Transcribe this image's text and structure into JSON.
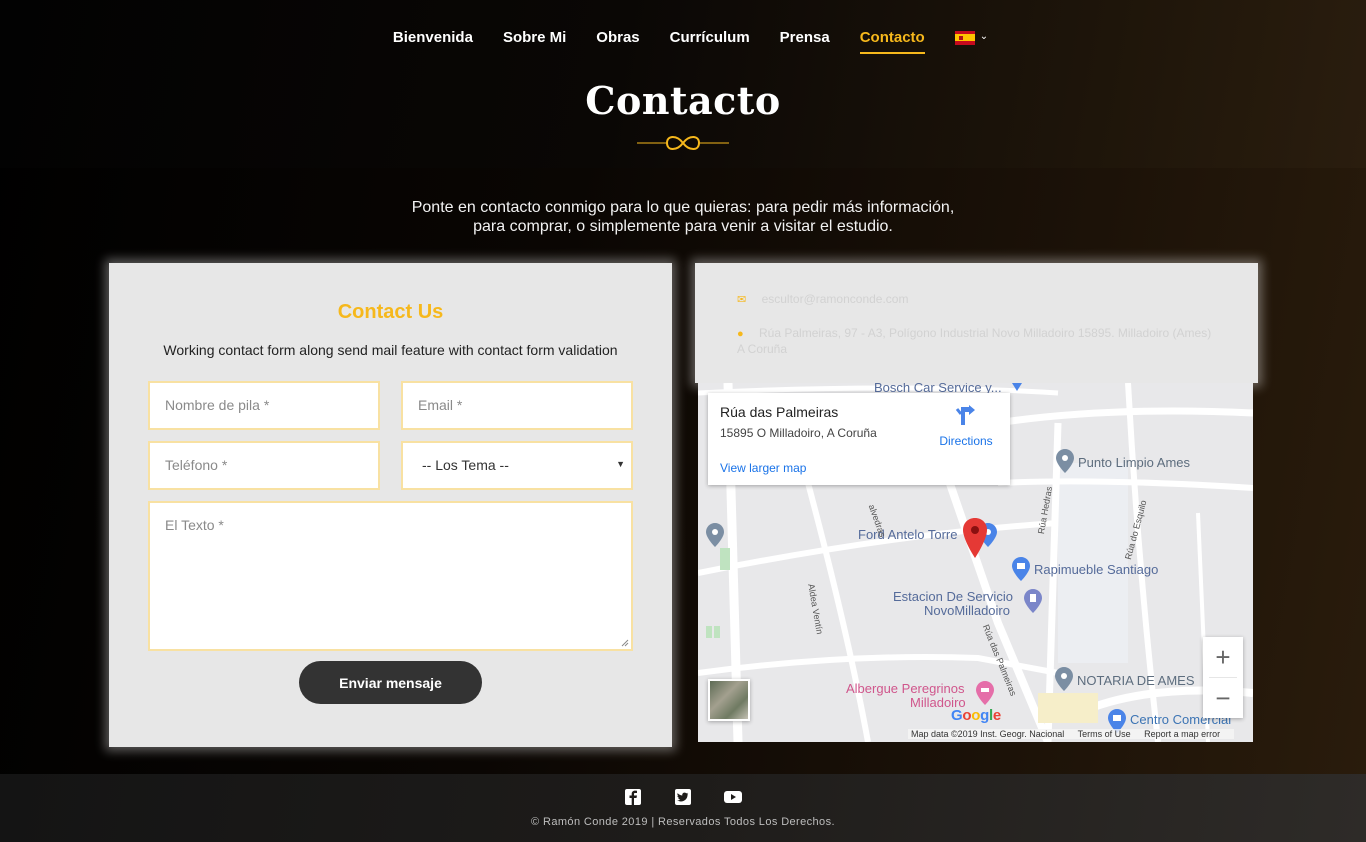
{
  "nav": {
    "items": [
      {
        "label": "Bienvenida"
      },
      {
        "label": "Sobre Mi"
      },
      {
        "label": "Obras"
      },
      {
        "label": "Currículum"
      },
      {
        "label": "Prensa"
      },
      {
        "label": "Contacto",
        "active": true
      }
    ],
    "language_icon": "spain-flag-icon"
  },
  "header": {
    "title": "Contacto"
  },
  "intro": {
    "line1": "Ponte en contacto conmigo para lo que quieras: para pedir más información,",
    "line2": "para comprar, o simplemente para venir a visitar el estudio."
  },
  "form": {
    "title": "Contact Us",
    "subtitle": "Working contact form along send mail feature with contact form validation",
    "name_placeholder": "Nombre de pila *",
    "email_placeholder": "Email *",
    "phone_placeholder": "Teléfono *",
    "topic_selected": "-- Los Tema --",
    "text_placeholder": "El Texto *",
    "submit_label": "Enviar mensaje"
  },
  "contact_info": {
    "email": "escultor@ramonconde.com",
    "address": "Rúa Palmeiras, 97 - A3, Polígono Industrial Novo Milladoiro 15895. Milladoiro (Ames) A Coruña"
  },
  "map": {
    "popup_title": "Rúa das Palmeiras",
    "popup_address": "15895 O Milladoiro, A Coruña",
    "directions_label": "Directions",
    "larger_map_label": "View larger map",
    "places": {
      "bosch": "Bosch Car Service y...",
      "punto_limpio": "Punto Limpio Ames",
      "ford": "Ford Antelo Torre",
      "rapimueble": "Rapimueble Santiago",
      "estacion_1": "Estacion De Servicio",
      "estacion_2": "NovoMilladoiro",
      "notaria": "NOTARIA DE AMES",
      "albergue_1": "Albergue Peregrinos",
      "albergue_2": "Milladoiro",
      "centro": "Centro Comercial"
    },
    "roads": {
      "aldea": "Aldea Ventín",
      "palmeiras": "Rúa das Palmeiras",
      "hedras": "Rúa Hedras",
      "esquilo": "Rúa do Esquilo",
      "alvedras": "alvedras"
    },
    "google": "Google",
    "map_data": "Map data ©2019 Inst. Geogr. Nacional",
    "terms": "Terms of Use",
    "report": "Report a map error",
    "zoom_in": "+",
    "zoom_out": "−"
  },
  "footer": {
    "social_icons": [
      "facebook-icon",
      "twitter-icon",
      "youtube-icon"
    ],
    "copyright": "© Ramón Conde 2019 | Reservados Todos Los Derechos."
  },
  "colors": {
    "accent": "#f6b81c",
    "card_bg": "#e7e7e7",
    "button_bg": "#333333",
    "field_border": "#f8e1a2"
  }
}
